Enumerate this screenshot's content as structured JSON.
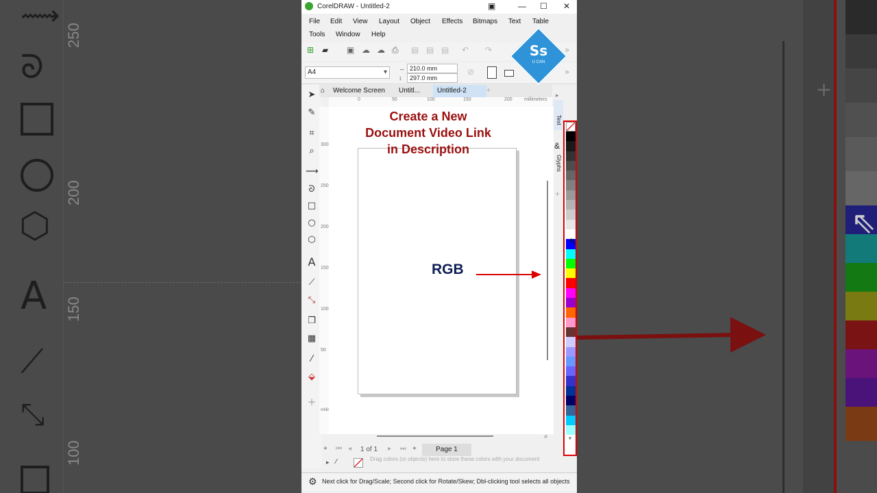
{
  "app": {
    "title": "CorelDRAW - Untitled-2",
    "window_controls": [
      "—",
      "☐",
      "✕"
    ]
  },
  "menu": {
    "items": [
      "File",
      "Edit",
      "View",
      "Layout",
      "Object",
      "Effects",
      "Bitmaps",
      "Text",
      "Table",
      "Tools",
      "Window",
      "Help"
    ]
  },
  "property_bar": {
    "page_size": "A4",
    "width": "210.0 mm",
    "height": "297.0 mm"
  },
  "tabs": [
    {
      "label": "Welcome Screen"
    },
    {
      "label": "Untitl..."
    },
    {
      "label": "Untitled-2"
    }
  ],
  "rulers": {
    "h_ticks": [
      "0",
      "50",
      "100",
      "150",
      "200"
    ],
    "h_unit": "millimeters",
    "v_ticks": [
      "300",
      "250",
      "200",
      "150",
      "100",
      "50"
    ],
    "v_unit": "millimeters"
  },
  "overlay": {
    "title_line1": "Create a New",
    "title_line2": "Document Video Link",
    "title_line3": "in Description",
    "label": "RGB",
    "logo_text": "Ss",
    "logo_sub": "U CAN"
  },
  "docker": {
    "text_tab": "Text",
    "glyphs_tab": "Glyphs"
  },
  "page_nav": {
    "counter": "1 of 1",
    "page_label": "Page 1"
  },
  "palette_hint": "Drag colors (or objects) here to store these colors with your document",
  "status": {
    "text": "Next click for Drag/Scale; Second click for Rotate/Skew; Dbl-clicking tool selects all objects"
  },
  "background_rulers": {
    "left": [
      "250",
      "200",
      "150",
      "100"
    ]
  },
  "palette": {
    "colors": [
      "#000000",
      "#1a1a1a",
      "#333333",
      "#4d4d4d",
      "#666666",
      "#808080",
      "#999999",
      "#b3b3b3",
      "#cccccc",
      "#e6e6e6",
      "#ffffff",
      "#0000ff",
      "#00ffff",
      "#00ff00",
      "#ffff00",
      "#ff0000",
      "#ff00ff",
      "#9900cc",
      "#ff6600",
      "#ff99cc",
      "#663333",
      "#ccccff",
      "#9999ff",
      "#6699ff",
      "#6666ff",
      "#3333cc",
      "#003399",
      "#000066",
      "#336699",
      "#00ccff",
      "#99ffff"
    ]
  }
}
